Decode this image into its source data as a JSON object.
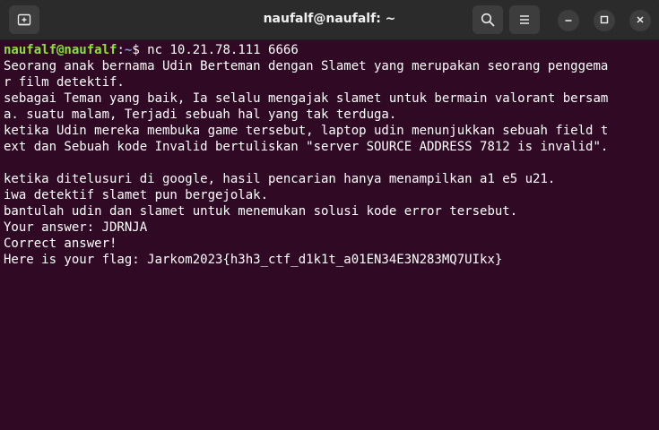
{
  "window": {
    "title": "naufalf@naufalf: ~"
  },
  "titlebar": {
    "new_tab_icon": "new-tab-icon",
    "search_icon": "search-icon",
    "menu_icon": "hamburger-menu-icon",
    "minimize_icon": "minimize-icon",
    "maximize_icon": "maximize-icon",
    "close_icon": "close-icon"
  },
  "terminal": {
    "prompt": {
      "user_host": "naufalf@naufalf",
      "colon": ":",
      "path": "~",
      "symbol": "$ ",
      "command": "nc 10.21.78.111 6666"
    },
    "lines": [
      "Seorang anak bernama Udin Berteman dengan Slamet yang merupakan seorang penggema",
      "r film detektif.",
      "sebagai Teman yang baik, Ia selalu mengajak slamet untuk bermain valorant bersam",
      "a. suatu malam, Terjadi sebuah hal yang tak terduga.",
      "ketika Udin mereka membuka game tersebut, laptop udin menunjukkan sebuah field t",
      "ext dan Sebuah kode Invalid bertuliskan \"server SOURCE ADDRESS 7812 is invalid\".",
      "",
      "ketika ditelusuri di google, hasil pencarian hanya menampilkan a1 e5 u21.",
      "iwa detektif slamet pun bergejolak.",
      "bantulah udin dan slamet untuk menemukan solusi kode error tersebut.",
      "Your answer: JDRNJA",
      "Correct answer!",
      "Here is your flag: Jarkom2023{h3h3_ctf_d1k1t_a01EN34E3N283MQ7UIkx}"
    ]
  },
  "colors": {
    "terminal_bg": "#300a24",
    "titlebar_bg": "#2b2b2b",
    "prompt_user": "#8ae234",
    "prompt_path": "#729fcf",
    "text": "#ffffff"
  }
}
